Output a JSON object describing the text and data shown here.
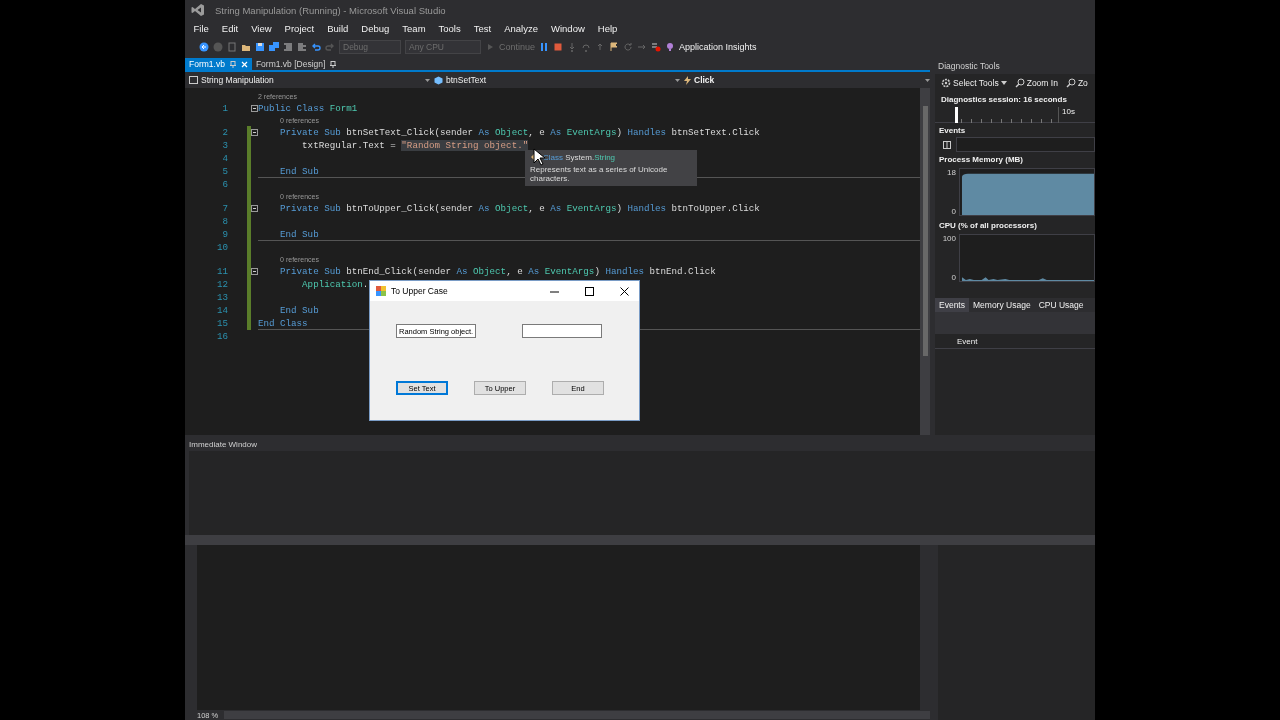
{
  "window": {
    "title": "String Manipulation (Running) - Microsoft Visual Studio"
  },
  "menu": [
    "File",
    "Edit",
    "View",
    "Project",
    "Build",
    "Debug",
    "Team",
    "Tools",
    "Test",
    "Analyze",
    "Window",
    "Help"
  ],
  "toolbar": {
    "configuration": {
      "value": "Debug",
      "disabled": true
    },
    "platform": {
      "value": "Any CPU",
      "disabled": true
    },
    "continue": {
      "label": "Continue",
      "disabled": true
    },
    "insights": "Application Insights"
  },
  "doc_tabs": [
    {
      "label": "Form1.vb",
      "selected": true
    },
    {
      "label": "Form1.vb [Design]",
      "selected": false
    }
  ],
  "nav_bar": [
    "String Manipulation",
    "btnSetText",
    "Click"
  ],
  "code": {
    "lines": [
      {
        "number": "1",
        "refs": "2 references",
        "modified": false,
        "collapsible": true,
        "separator_after": false,
        "tokens": [
          {
            "kind": "keyword",
            "text": "Public Class "
          },
          {
            "kind": "type",
            "text": "Form1"
          }
        ]
      },
      {
        "number": "2",
        "refs": "0 references",
        "modified": true,
        "collapsible": true,
        "separator_after": false,
        "tokens": [
          {
            "kind": "keyword",
            "text": "    Private Sub "
          },
          {
            "kind": "plain",
            "text": "btnSetText_Click(sender "
          },
          {
            "kind": "keyword",
            "text": "As "
          },
          {
            "kind": "type",
            "text": "Object"
          },
          {
            "kind": "plain",
            "text": ", e "
          },
          {
            "kind": "keyword",
            "text": "As "
          },
          {
            "kind": "type",
            "text": "EventArgs"
          },
          {
            "kind": "plain",
            "text": ") "
          },
          {
            "kind": "keyword",
            "text": "Handles "
          },
          {
            "kind": "plain",
            "text": "btnSetText.Click"
          }
        ]
      },
      {
        "number": "3",
        "modified": true,
        "collapsible": false,
        "separator_after": false,
        "tokens": [
          {
            "kind": "plain",
            "text": "        txtRegular.Text = "
          },
          {
            "kind": "string",
            "text": "\"Random String object.\"",
            "highlighted": true
          }
        ]
      },
      {
        "number": "4",
        "modified": true,
        "collapsible": false,
        "separator_after": false
      },
      {
        "number": "5",
        "modified": true,
        "collapsible": false,
        "separator_after": true,
        "tokens": [
          {
            "kind": "keyword",
            "text": "    End Sub"
          }
        ]
      },
      {
        "number": "6",
        "modified": true,
        "collapsible": false,
        "separator_after": false
      },
      {
        "number": "7",
        "refs": "0 references",
        "modified": true,
        "collapsible": true,
        "separator_after": false,
        "tokens": [
          {
            "kind": "keyword",
            "text": "    Private Sub "
          },
          {
            "kind": "plain",
            "text": "btnToUpper_Click(sender "
          },
          {
            "kind": "keyword",
            "text": "As "
          },
          {
            "kind": "type",
            "text": "Object"
          },
          {
            "kind": "plain",
            "text": ", e "
          },
          {
            "kind": "keyword",
            "text": "As "
          },
          {
            "kind": "type",
            "text": "EventArgs"
          },
          {
            "kind": "plain",
            "text": ") "
          },
          {
            "kind": "keyword",
            "text": "Handles "
          },
          {
            "kind": "plain",
            "text": "btnToUpper.Click"
          }
        ]
      },
      {
        "number": "8",
        "modified": true,
        "collapsible": false,
        "separator_after": false
      },
      {
        "number": "9",
        "modified": true,
        "collapsible": false,
        "separator_after": true,
        "tokens": [
          {
            "kind": "keyword",
            "text": "    End Sub"
          }
        ]
      },
      {
        "number": "10",
        "modified": true,
        "collapsible": false,
        "separator_after": false
      },
      {
        "number": "11",
        "refs": "0 references",
        "modified": true,
        "collapsible": true,
        "separator_after": false,
        "tokens": [
          {
            "kind": "keyword",
            "text": "    Private Sub "
          },
          {
            "kind": "plain",
            "text": "btnEnd_Click(sender "
          },
          {
            "kind": "keyword",
            "text": "As "
          },
          {
            "kind": "type",
            "text": "Object"
          },
          {
            "kind": "plain",
            "text": ", e "
          },
          {
            "kind": "keyword",
            "text": "As "
          },
          {
            "kind": "type",
            "text": "EventArgs"
          },
          {
            "kind": "plain",
            "text": ") "
          },
          {
            "kind": "keyword",
            "text": "Handles "
          },
          {
            "kind": "plain",
            "text": "btnEnd.Click"
          }
        ]
      },
      {
        "number": "12",
        "modified": true,
        "collapsible": false,
        "separator_after": false,
        "tokens": [
          {
            "kind": "type",
            "text": "        Application"
          },
          {
            "kind": "plain",
            "text": "."
          }
        ]
      },
      {
        "number": "13",
        "modified": true,
        "collapsible": false,
        "separator_after": false
      },
      {
        "number": "14",
        "modified": true,
        "collapsible": false,
        "separator_after": false,
        "tokens": [
          {
            "kind": "keyword",
            "text": "    End Sub"
          }
        ]
      },
      {
        "number": "15",
        "modified": true,
        "collapsible": false,
        "separator_after": true,
        "tokens": [
          {
            "kind": "keyword",
            "text": "End Class"
          }
        ]
      },
      {
        "number": "16",
        "modified": false,
        "collapsible": false,
        "separator_after": false
      }
    ]
  },
  "tooltip": {
    "keyword": "Class",
    "namespace": "System.",
    "type": "String",
    "summary": "Represents text as a series of Unicode characters."
  },
  "dialog": {
    "title": "To Upper Case",
    "fields": [
      {
        "kind": "textbox",
        "value": "Random String object."
      },
      {
        "kind": "textbox"
      }
    ],
    "buttons": [
      {
        "label": "Set Text",
        "focused": true
      },
      {
        "label": "To Upper",
        "focused": false
      },
      {
        "label": "End",
        "focused": false
      }
    ]
  },
  "immediate_window": {
    "title": "Immediate Window"
  },
  "zoom": "108 %",
  "diagnostics": {
    "title": "Diagnostic Tools",
    "tools": [
      "Select Tools",
      "Zoom In",
      "Zo"
    ],
    "session": "Diagnostics session: 16 seconds",
    "ruler_label": "10s",
    "events_title": "Events",
    "graphs": [
      {
        "kind": "memory",
        "title": "Process Memory (MB)",
        "top_label": "18",
        "bottom_label": "0"
      },
      {
        "kind": "cpu",
        "title": "CPU (% of all processors)",
        "top_label": "100",
        "bottom_label": "0"
      }
    ],
    "tabs": [
      {
        "label": "Events",
        "selected": true
      },
      {
        "label": "Memory Usage",
        "selected": false
      },
      {
        "label": "CPU Usage",
        "selected": false
      }
    ],
    "table_header": "Event"
  }
}
